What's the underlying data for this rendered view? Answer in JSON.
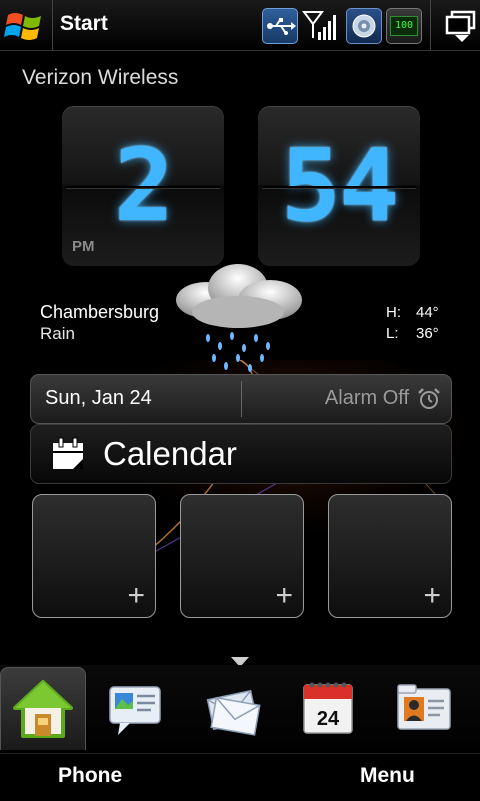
{
  "status_bar": {
    "start_label": "Start",
    "battery_text": "100",
    "icons": [
      "windows-logo-icon",
      "usb-icon",
      "signal-icon",
      "sound-icon",
      "battery-icon",
      "task-switcher-icon"
    ]
  },
  "home": {
    "carrier": "Verizon Wireless",
    "clock": {
      "hour": "2",
      "minutes": "54",
      "ampm": "PM"
    },
    "weather": {
      "city": "Chambersburg",
      "condition": "Rain",
      "high_label": "H:",
      "high_value": "44°",
      "low_label": "L:",
      "low_value": "36°"
    },
    "date": "Sun, Jan 24",
    "alarm": "Alarm Off",
    "calendar_label": "Calendar",
    "slots": [
      {
        "symbol": "+"
      },
      {
        "symbol": "+"
      },
      {
        "symbol": "+"
      }
    ]
  },
  "tabs": {
    "calendar_day": "24",
    "items": [
      "home",
      "messages",
      "mail",
      "calendar",
      "contacts"
    ]
  },
  "softkeys": {
    "left": "Phone",
    "right": "Menu"
  },
  "colors": {
    "clock_digits": "#3fb6ff",
    "background": "#000000"
  }
}
